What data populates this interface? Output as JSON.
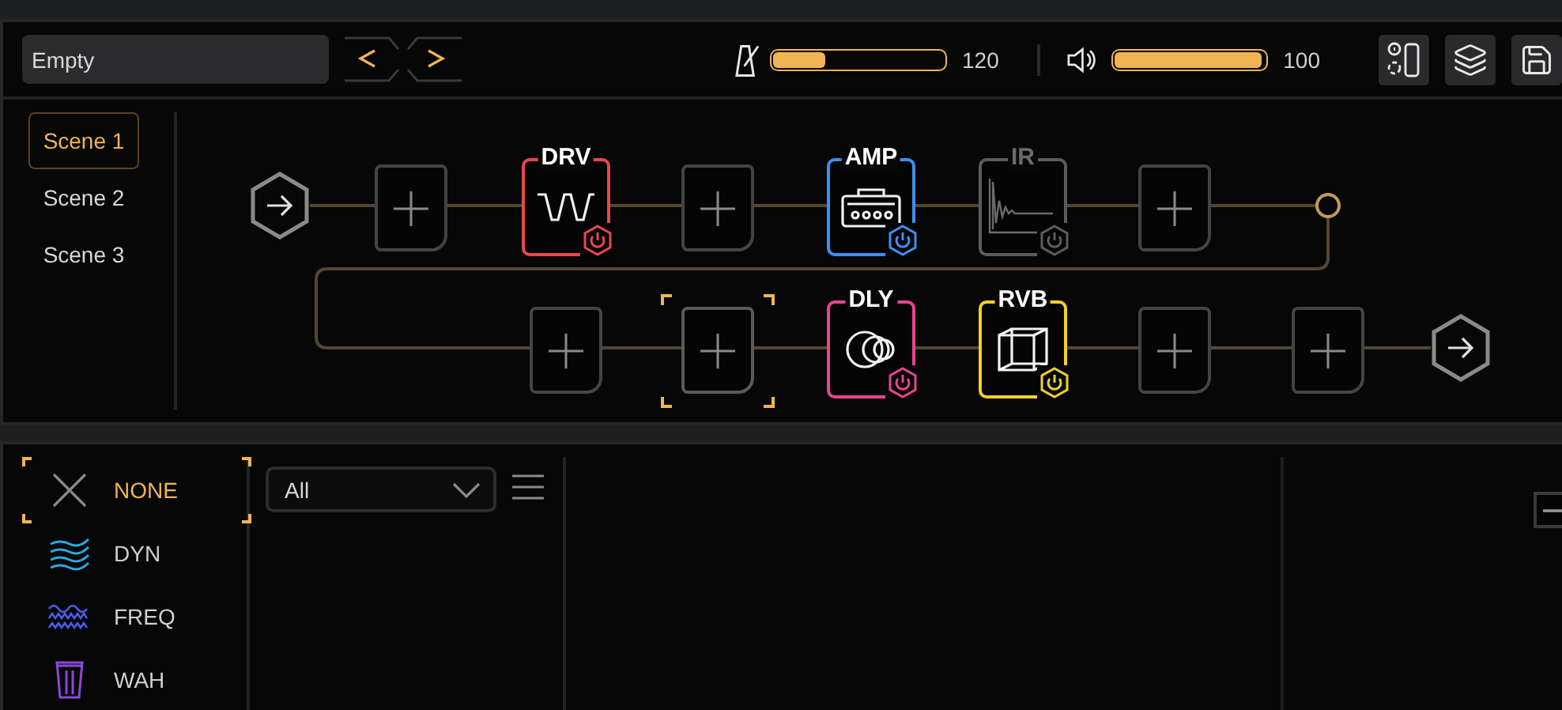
{
  "preset": {
    "name": "Empty"
  },
  "tempo": {
    "level": 0.31,
    "reading": "120"
  },
  "volume": {
    "level": 0.98,
    "reading": "100"
  },
  "scenes": [
    {
      "label": "Scene 1",
      "selected": true
    },
    {
      "label": "Scene 2",
      "selected": false
    },
    {
      "label": "Scene 3",
      "selected": false
    }
  ],
  "chain": {
    "rows": [
      {
        "nodes": [
          {
            "kind": "input"
          },
          {
            "kind": "empty",
            "selected": false
          },
          {
            "kind": "drive",
            "label": "DRV",
            "color": "#e8474b",
            "enabled": true
          },
          {
            "kind": "empty",
            "selected": false
          },
          {
            "kind": "amp",
            "label": "AMP",
            "color": "#3f8ef0",
            "enabled": true
          },
          {
            "kind": "ir",
            "label": "IR",
            "color": "#5c5c5c",
            "enabled": false
          },
          {
            "kind": "empty",
            "selected": false
          },
          {
            "kind": "split"
          }
        ]
      },
      {
        "nodes": [
          {
            "kind": "empty",
            "selected": false
          },
          {
            "kind": "empty",
            "selected": true
          },
          {
            "kind": "delay",
            "label": "DLY",
            "color": "#e8448e",
            "enabled": true
          },
          {
            "kind": "reverb",
            "label": "RVB",
            "color": "#f0d02a",
            "enabled": true
          },
          {
            "kind": "empty",
            "selected": false
          },
          {
            "kind": "empty",
            "selected": false
          },
          {
            "kind": "output"
          }
        ]
      }
    ]
  },
  "categories": [
    {
      "kind": "none",
      "label": "NONE",
      "selected": true,
      "color": "#8a8a8a"
    },
    {
      "kind": "dynamics",
      "label": "DYN",
      "selected": false,
      "color": "#2aa8e4"
    },
    {
      "kind": "frequency",
      "label": "FREQ",
      "selected": false,
      "color": "#4a5ae8"
    },
    {
      "kind": "wah",
      "label": "WAH",
      "selected": false,
      "color": "#8a48d8"
    }
  ],
  "filter": {
    "value": "All"
  }
}
